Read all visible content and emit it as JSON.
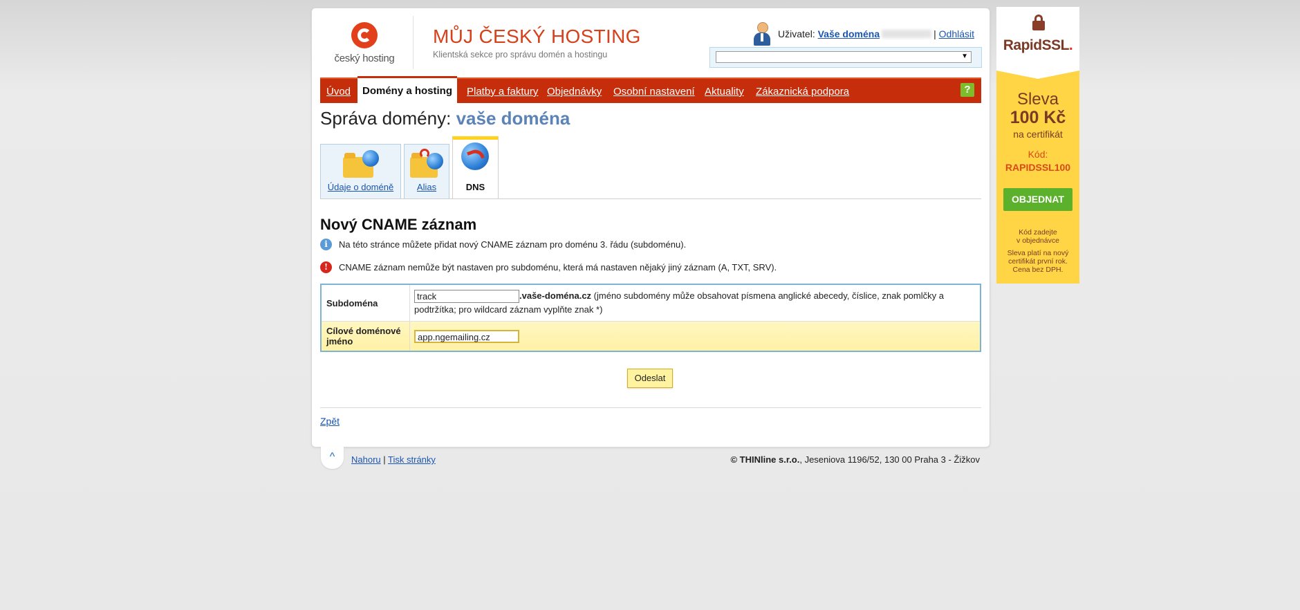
{
  "header": {
    "logo_text": "český hosting",
    "title": "MŮJ ČESKÝ HOSTING",
    "subtitle": "Klientská sekce pro správu domén a hostingu",
    "user_label": "Uživatel:",
    "user_name": "Vaše doména",
    "separator": "|",
    "logout": "Odhlásit"
  },
  "nav": {
    "items": [
      "Úvod",
      "Domény a hosting",
      "Platby a faktury",
      "Objednávky",
      "Osobní nastavení",
      "Aktuality",
      "Zákaznická podpora"
    ],
    "active": "Domény a hosting",
    "help": "?"
  },
  "page": {
    "title_prefix": "Správa domény:",
    "title_domain": "vaše doména"
  },
  "tabs": [
    {
      "label": "Údaje o doméně",
      "icon": "folder-globe-icon"
    },
    {
      "label": "Alias",
      "icon": "folder-alias-icon"
    },
    {
      "label": "DNS",
      "icon": "dns-globe-icon"
    }
  ],
  "content": {
    "heading": "Nový CNAME záznam",
    "info": "Na této stránce můžete přidat nový CNAME záznam pro doménu 3. řádu (subdoménu).",
    "warning": "CNAME záznam nemůže být nastaven pro subdoménu, která má nastaven nějaký jiný záznam (A, TXT, SRV).",
    "form": {
      "subdomain_label": "Subdoména",
      "subdomain_value": "track",
      "subdomain_suffix": ".vaše-doména.cz",
      "subdomain_hint": "(jméno subdomény může obsahovat písmena anglické abecedy, číslice, znak pomlčky a podtržítka; pro wildcard záznam vyplňte znak *)",
      "target_label": "Cílové doménové jméno",
      "target_value": "app.ngemailing.cz"
    },
    "submit": "Odeslat",
    "back": "Zpět"
  },
  "footer": {
    "top_arrow": "^",
    "to_top": "Nahoru",
    "sep": "|",
    "print": "Tisk stránky",
    "company": "© THINline s.r.o.",
    "address": ", Jeseniova 1196/52, 130 00 Praha 3 - Žižkov"
  },
  "banner": {
    "brand": "RapidSSL",
    "brand_mark": ".",
    "line1": "Sleva",
    "line2": "100 Kč",
    "line3": "na certifikát",
    "code_label": "Kód:",
    "code": "RAPIDSSL100",
    "button": "OBJEDNAT",
    "note1a": "Kód zadejte",
    "note1b": "v objednávce",
    "note2": "Sleva platí na nový certifikát první rok. Cena bez DPH."
  },
  "colors": {
    "brand_red": "#c62d0b",
    "link_blue": "#1a55b0",
    "domain_blue": "#5b83b6",
    "banner_yellow": "#ffd445",
    "button_green": "#5bb12b"
  }
}
